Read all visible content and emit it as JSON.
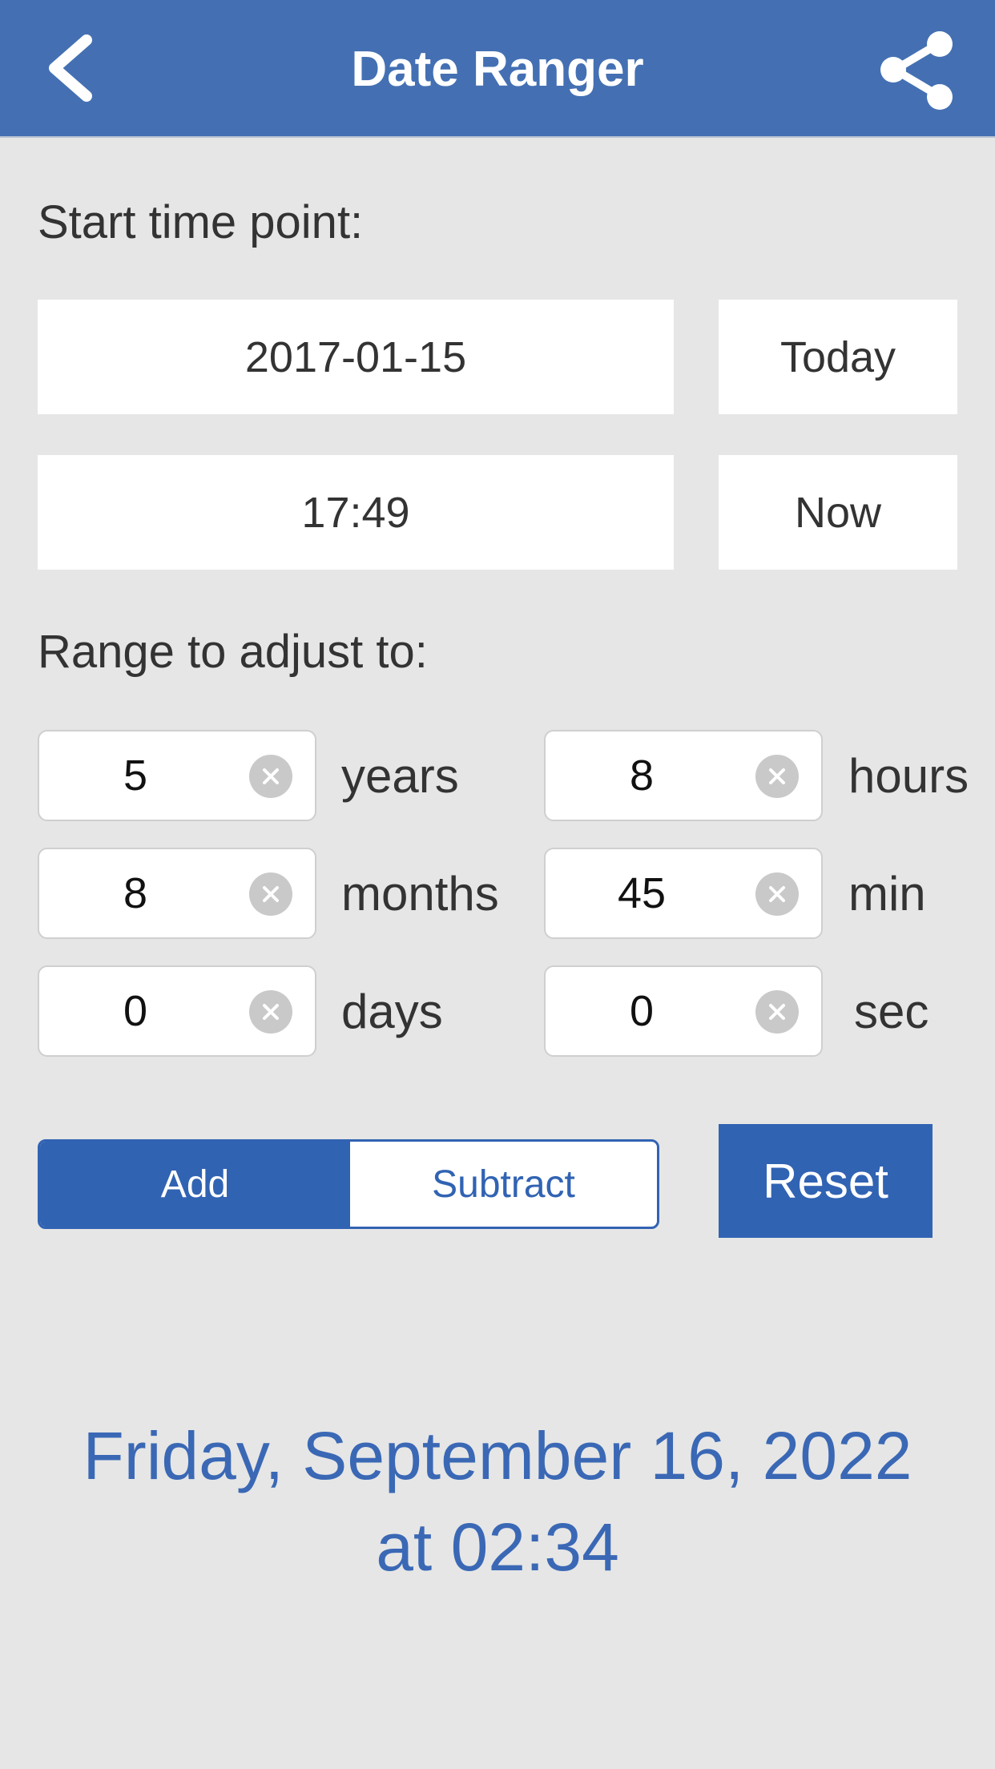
{
  "header": {
    "title": "Date Ranger",
    "back_icon": "chevron-left-icon",
    "share_icon": "share-icon",
    "color": "#4470b3"
  },
  "start": {
    "label": "Start time point:",
    "date_value": "2017-01-15",
    "today_label": "Today",
    "time_value": "17:49",
    "now_label": "Now"
  },
  "range": {
    "label": "Range to adjust to:",
    "years": {
      "value": "5",
      "unit": "years"
    },
    "months": {
      "value": "8",
      "unit": "months"
    },
    "days": {
      "value": "0",
      "unit": "days"
    },
    "hours": {
      "value": "8",
      "unit": "hours"
    },
    "minutes": {
      "value": "45",
      "unit": "min"
    },
    "seconds": {
      "value": "0",
      "unit": "sec"
    }
  },
  "mode": {
    "add_label": "Add",
    "subtract_label": "Subtract",
    "selected": "Add",
    "accent": "#3163b3"
  },
  "reset_label": "Reset",
  "result": {
    "line1": "Friday, September 16, 2022",
    "line2": "at 02:34",
    "color": "#3a68b5"
  }
}
